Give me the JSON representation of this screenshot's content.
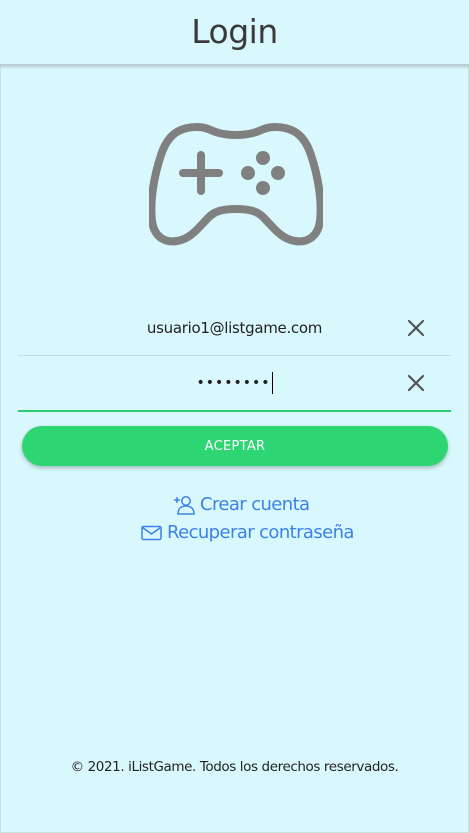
{
  "header": {
    "title": "Login"
  },
  "logo": {
    "icon": "gamepad-icon",
    "color": "#808080"
  },
  "form": {
    "email_value": "usuario1@listgame.com",
    "password_masked": "••••••••",
    "clear_icon": "close-icon",
    "accept_label": "ACEPTAR"
  },
  "links": {
    "create_account": {
      "label": "Crear cuenta",
      "icon": "add-user-icon"
    },
    "recover_password": {
      "label": "Recuperar contraseña",
      "icon": "mail-icon"
    }
  },
  "footer": {
    "text": "© 2021. iListGame. Todos los derechos reservados."
  },
  "colors": {
    "background": "#d9f8fd",
    "accent": "#2ed573",
    "link": "#3b82e8"
  }
}
